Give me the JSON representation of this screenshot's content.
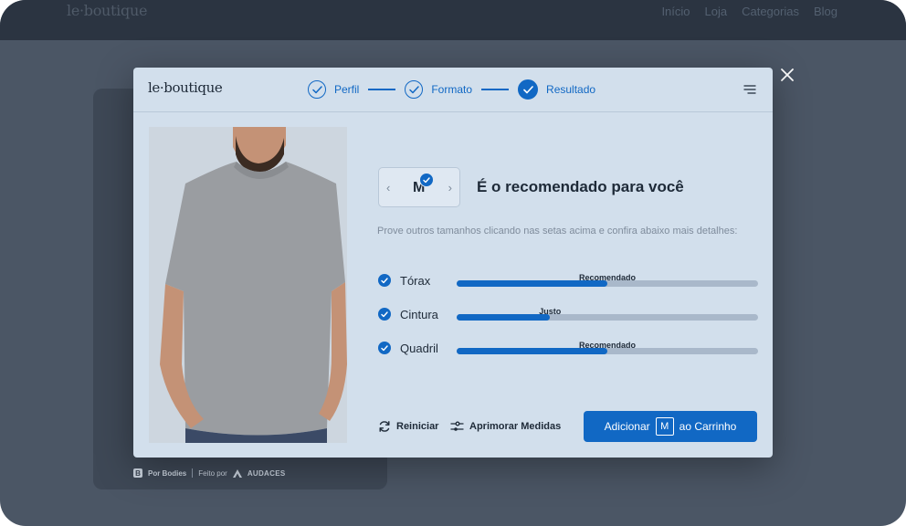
{
  "background": {
    "logo": "le·boutique",
    "nav": [
      {
        "label": "Início"
      },
      {
        "label": "Loja"
      },
      {
        "label": "Categorias"
      },
      {
        "label": "Blog"
      }
    ],
    "footer": {
      "by_label": "Por Bodies",
      "made_by": "Feito por",
      "brand": "AUDACES"
    }
  },
  "modal": {
    "logo": "le·boutique",
    "steps": [
      {
        "label": "Perfil",
        "state": "done"
      },
      {
        "label": "Formato",
        "state": "done"
      },
      {
        "label": "Resultado",
        "state": "current"
      }
    ],
    "size": "M",
    "title": "É o recomendado para você",
    "hint": "Prove outros tamanhos clicando nas setas acima e confira abaixo mais detalhes:",
    "measures": [
      {
        "name": "Tórax",
        "tag": "Recomendado",
        "fill": 0.5
      },
      {
        "name": "Cintura",
        "tag": "Justo",
        "fill": 0.31
      },
      {
        "name": "Quadril",
        "tag": "Recomendado",
        "fill": 0.5
      }
    ],
    "actions": {
      "restart": "Reiniciar",
      "refine": "Aprimorar Medidas",
      "add_prefix": "Adicionar",
      "add_size": "M",
      "add_suffix": "ao Carrinho"
    }
  },
  "colors": {
    "accent": "#1168c4",
    "modal_bg": "#d2dfec",
    "overlay": "#4b5665"
  },
  "icons": [
    "close-icon",
    "menu-icon",
    "check-icon",
    "chevron-left-icon",
    "chevron-right-icon",
    "refresh-icon",
    "sliders-icon"
  ]
}
